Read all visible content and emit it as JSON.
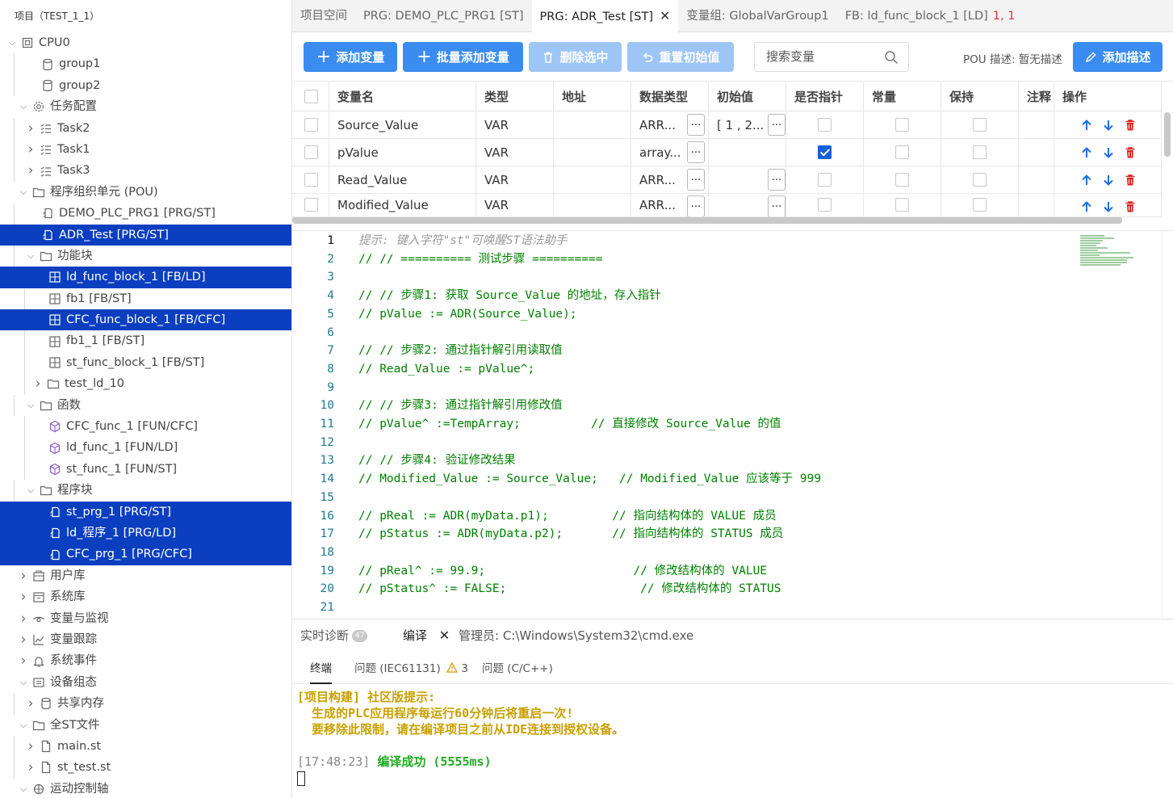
{
  "sidebar": {
    "header": "项目（TEST_1_1）",
    "items": [
      {
        "label": "CPU0",
        "depth": 0,
        "chevron": "down",
        "icon": "cpu-icon",
        "selected": false
      },
      {
        "label": "group1",
        "depth": 2,
        "chevron": "",
        "icon": "database-icon",
        "selected": false
      },
      {
        "label": "group2",
        "depth": 2,
        "chevron": "",
        "icon": "database-icon",
        "selected": false
      },
      {
        "label": "任务配置",
        "depth": 1,
        "chevron": "down",
        "icon": "gear-icon",
        "selected": false
      },
      {
        "label": "Task2",
        "depth": 2,
        "chevron": "right",
        "icon": "task-list-icon",
        "selected": false
      },
      {
        "label": "Task1",
        "depth": 2,
        "chevron": "right",
        "icon": "task-list-icon",
        "selected": false
      },
      {
        "label": "Task3",
        "depth": 2,
        "chevron": "right",
        "icon": "task-list-icon",
        "selected": false
      },
      {
        "label": "程序组织单元 (POU)",
        "depth": 1,
        "chevron": "down",
        "icon": "folder-icon",
        "selected": false
      },
      {
        "label": "DEMO_PLC_PRG1 [PRG/ST]",
        "depth": 2,
        "chevron": "",
        "icon": "program-icon",
        "selected": false
      },
      {
        "label": "ADR_Test [PRG/ST]",
        "depth": 2,
        "chevron": "",
        "icon": "program-icon",
        "selected": true
      },
      {
        "label": "功能块",
        "depth": 2,
        "chevron": "down",
        "icon": "folder-icon",
        "selected": false
      },
      {
        "label": "ld_func_block_1 [FB/LD]",
        "depth": 3,
        "chevron": "",
        "icon": "function-block-icon",
        "selected": true
      },
      {
        "label": "fb1 [FB/ST]",
        "depth": 3,
        "chevron": "",
        "icon": "function-block-icon",
        "selected": false
      },
      {
        "label": "CFC_func_block_1 [FB/CFC]",
        "depth": 3,
        "chevron": "",
        "icon": "function-block-icon",
        "selected": true
      },
      {
        "label": "fb1_1 [FB/ST]",
        "depth": 3,
        "chevron": "",
        "icon": "function-block-icon",
        "selected": false
      },
      {
        "label": "st_func_block_1 [FB/ST]",
        "depth": 3,
        "chevron": "",
        "icon": "function-block-icon",
        "selected": false
      },
      {
        "label": "test_ld_10",
        "depth": 3,
        "chevron": "right",
        "icon": "folder-icon",
        "selected": false
      },
      {
        "label": "函数",
        "depth": 2,
        "chevron": "down",
        "icon": "folder-icon",
        "selected": false
      },
      {
        "label": "CFC_func_1 [FUN/CFC]",
        "depth": 3,
        "chevron": "",
        "icon": "function-icon",
        "selected": false
      },
      {
        "label": "ld_func_1 [FUN/LD]",
        "depth": 3,
        "chevron": "",
        "icon": "function-icon",
        "selected": false
      },
      {
        "label": "st_func_1 [FUN/ST]",
        "depth": 3,
        "chevron": "",
        "icon": "function-icon",
        "selected": false
      },
      {
        "label": "程序块",
        "depth": 2,
        "chevron": "down",
        "icon": "folder-icon",
        "selected": false
      },
      {
        "label": "st_prg_1 [PRG/ST]",
        "depth": 3,
        "chevron": "",
        "icon": "program-icon",
        "selected": true
      },
      {
        "label": "ld_程序_1 [PRG/LD]",
        "depth": 3,
        "chevron": "",
        "icon": "program-icon",
        "selected": true
      },
      {
        "label": "CFC_prg_1 [PRG/CFC]",
        "depth": 3,
        "chevron": "",
        "icon": "program-icon",
        "selected": true
      },
      {
        "label": "用户库",
        "depth": 1,
        "chevron": "right",
        "icon": "library-icon",
        "selected": false
      },
      {
        "label": "系统库",
        "depth": 1,
        "chevron": "right",
        "icon": "system-library-icon",
        "selected": false
      },
      {
        "label": "变量与监视",
        "depth": 1,
        "chevron": "right",
        "icon": "eye-icon",
        "selected": false
      },
      {
        "label": "变量跟踪",
        "depth": 1,
        "chevron": "right",
        "icon": "trend-icon",
        "selected": false
      },
      {
        "label": "系统事件",
        "depth": 1,
        "chevron": "right",
        "icon": "bell-icon",
        "selected": false
      },
      {
        "label": "设备组态",
        "depth": 1,
        "chevron": "down",
        "icon": "device-icon",
        "selected": false
      },
      {
        "label": "共享内存",
        "depth": 2,
        "chevron": "right",
        "icon": "database-icon",
        "selected": false
      },
      {
        "label": "全ST文件",
        "depth": 1,
        "chevron": "down",
        "icon": "folder-icon",
        "selected": false
      },
      {
        "label": "main.st",
        "depth": 2,
        "chevron": "right",
        "icon": "file-icon",
        "selected": false
      },
      {
        "label": "st_test.st",
        "depth": 2,
        "chevron": "right",
        "icon": "file-icon",
        "selected": false
      },
      {
        "label": "运动控制轴",
        "depth": 1,
        "chevron": "down",
        "icon": "axis-icon",
        "selected": false
      }
    ]
  },
  "tabs": [
    {
      "label": "项目空间",
      "active": false,
      "close": false,
      "err": ""
    },
    {
      "label": "PRG: DEMO_PLC_PRG1 [ST]",
      "active": false,
      "close": false,
      "err": ""
    },
    {
      "label": "PRG: ADR_Test [ST]",
      "active": true,
      "close": true,
      "err": ""
    },
    {
      "label": "变量组: GlobalVarGroup1",
      "active": false,
      "close": false,
      "err": ""
    },
    {
      "label": "FB: ld_func_block_1 [LD]",
      "active": false,
      "close": false,
      "err": "1, 1"
    }
  ],
  "toolbar": {
    "add_var": "添加变量",
    "batch_add": "批量添加变量",
    "delete_selected": "删除选中",
    "reset_init": "重置初始值",
    "search_placeholder": "搜索变量",
    "pou_desc": "POU 描述: 暂无描述",
    "add_desc": "添加描述"
  },
  "table": {
    "headers": [
      "变量名",
      "类型",
      "地址",
      "数据类型",
      "初始值",
      "是否指针",
      "常量",
      "保持",
      "注释",
      "操作"
    ],
    "rows": [
      {
        "name": "Source_Value",
        "kind": "VAR",
        "address": "",
        "dtype": "ARR...",
        "init": "[ 1 , 2...",
        "pointer": false,
        "const": false,
        "retain": false,
        "comment": ""
      },
      {
        "name": "pValue",
        "kind": "VAR",
        "address": "",
        "dtype": "array...",
        "init": "",
        "pointer": true,
        "const": false,
        "retain": false,
        "comment": ""
      },
      {
        "name": "Read_Value",
        "kind": "VAR",
        "address": "",
        "dtype": "ARR...",
        "init": "",
        "pointer": false,
        "const": false,
        "retain": false,
        "comment": ""
      },
      {
        "name": "Modified_Value",
        "kind": "VAR",
        "address": "",
        "dtype": "ARR...",
        "init": "",
        "pointer": false,
        "const": false,
        "retain": false,
        "comment": ""
      }
    ],
    "dots_label": "..."
  },
  "editor": {
    "current_line": 1,
    "lines": [
      {
        "n": "1",
        "text": "提示: 键入字符\"st\"可唤醒ST语法助手",
        "hint": true
      },
      {
        "n": "2",
        "text": "// // ========== 测试步骤 ==========",
        "hint": false
      },
      {
        "n": "3",
        "text": "",
        "hint": false
      },
      {
        "n": "4",
        "text": "// // 步骤1: 获取 Source_Value 的地址，存入指针",
        "hint": false
      },
      {
        "n": "5",
        "text": "// pValue := ADR(Source_Value);",
        "hint": false
      },
      {
        "n": "6",
        "text": "",
        "hint": false
      },
      {
        "n": "7",
        "text": "// // 步骤2: 通过指针解引用读取值",
        "hint": false
      },
      {
        "n": "8",
        "text": "// Read_Value := pValue^;",
        "hint": false
      },
      {
        "n": "9",
        "text": "",
        "hint": false
      },
      {
        "n": "10",
        "text": "// // 步骤3: 通过指针解引用修改值",
        "hint": false
      },
      {
        "n": "11",
        "text": "// pValue^ :=TempArray;          // 直接修改 Source_Value 的值",
        "hint": false
      },
      {
        "n": "12",
        "text": "",
        "hint": false
      },
      {
        "n": "13",
        "text": "// // 步骤4: 验证修改结果",
        "hint": false
      },
      {
        "n": "14",
        "text": "// Modified_Value := Source_Value;   // Modified_Value 应该等于 999",
        "hint": false
      },
      {
        "n": "15",
        "text": "",
        "hint": false
      },
      {
        "n": "16",
        "text": "// pReal := ADR(myData.p1);         // 指向结构体的 VALUE 成员",
        "hint": false
      },
      {
        "n": "17",
        "text": "// pStatus := ADR(myData.p2);       // 指向结构体的 STATUS 成员",
        "hint": false
      },
      {
        "n": "18",
        "text": "",
        "hint": false
      },
      {
        "n": "19",
        "text": "// pReal^ := 99.9;                     // 修改结构体的 VALUE",
        "hint": false
      },
      {
        "n": "20",
        "text": "// pStatus^ := FALSE;                   // 修改结构体的 STATUS",
        "hint": false
      },
      {
        "n": "21",
        "text": "",
        "hint": false
      }
    ]
  },
  "panel": {
    "tab_diag": "实时诊断",
    "diag_count": "47",
    "tab_compile": "编译",
    "tab_cmd": "管理员: C:\\Windows\\System32\\cmd.exe",
    "sub_terminal": "终端",
    "sub_iec": "问题 (IEC61131)",
    "iec_count": "3",
    "sub_cpp": "问题 (C/C++)",
    "term_line1": "[项目构建] 社区版提示:",
    "term_line2": "  生成的PLC应用程序每运行60分钟后将重启一次!",
    "term_line3": "  要移除此限制，请在编译项目之前从IDE连接到授权设备。",
    "term_time": "[17:48:23]",
    "term_success": "编译成功 (5555ms)"
  },
  "colors": {
    "selection": "#0b3fbf",
    "primary": "#3a8cf0",
    "disabled": "#9dc6f6",
    "comment": "#008000",
    "warning": "#c9a000",
    "success": "#1fad1f",
    "error": "#dd3333"
  }
}
